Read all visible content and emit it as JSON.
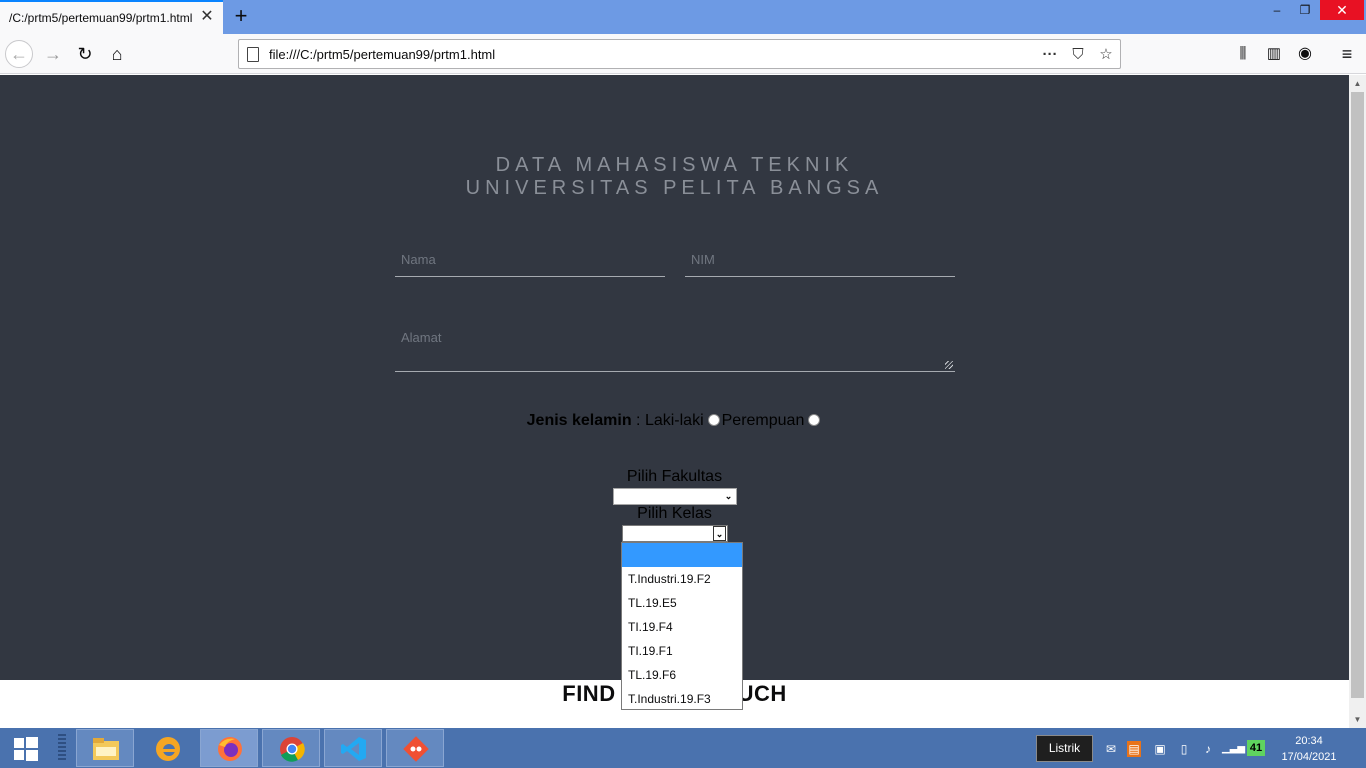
{
  "browser": {
    "tab_title": "/C:/prtm5/pertemuan99/prtm1.html",
    "url": "file:///C:/prtm5/pertemuan99/prtm1.html"
  },
  "page": {
    "title_line1": "DATA MAHASISWA TEKNIK",
    "title_line2": "UNIVERSITAS PELITA BANGSA",
    "nama_placeholder": "Nama",
    "nim_placeholder": "NIM",
    "alamat_placeholder": "Alamat",
    "gender_label": "Jenis kelamin",
    "gender_sep": " : ",
    "gender_male": "Laki-laki",
    "gender_female": "Perempuan",
    "fakultas_label": "Pilih Fakultas",
    "kelas_label": "Pilih Kelas",
    "footer_left": "FIND",
    "footer_right": "UCH"
  },
  "kelas_options": [
    "",
    "T.Industri.19.F2",
    "TL.19.E5",
    "TI.19.F4",
    "TI.19.F1",
    "TL.19.F6",
    "T.Industri.19.F3"
  ],
  "taskbar": {
    "tooltip": "Listrik",
    "battery": "41",
    "time": "20:34",
    "date": "17/04/2021"
  },
  "colors": {
    "hero_bg": "#323741",
    "dropdown_highlight": "#3399ff",
    "taskbar_bg": "#4a72ae",
    "tabstrip_bg": "#6d9ae4"
  }
}
